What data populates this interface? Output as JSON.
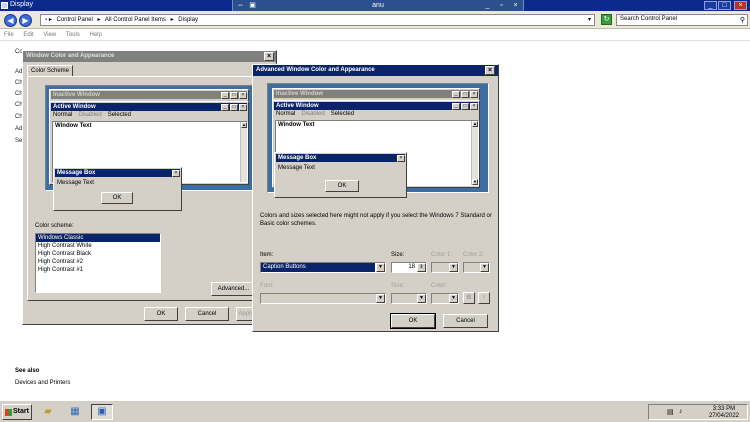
{
  "explorer": {
    "title": "Display",
    "remote_title": "anu",
    "path": [
      "Control Panel",
      "All Control Panel Items",
      "Display"
    ],
    "path_sep": "▸",
    "search_placeholder": "Search Control Panel",
    "menu": [
      "File",
      "Edit",
      "View",
      "Tools",
      "Help"
    ],
    "left_letters": [
      "Co",
      "Ad",
      "Ch",
      "Ch",
      "Ch",
      "Ch",
      "Ad",
      "Se"
    ],
    "see_also_heading": "See also",
    "see_also_link": "Devices and Printers"
  },
  "wca": {
    "title": "Window Color and Appearance",
    "tab": "Color Scheme",
    "preview": {
      "inactive_title": "Inactive Window",
      "active_title": "Active Window",
      "menu_normal": "Normal",
      "menu_disabled": "Disabled",
      "menu_selected": "Selected",
      "window_text": "Window Text",
      "msgbox_title": "Message Box",
      "msgbox_text": "Message Text",
      "ok": "OK"
    },
    "scheme_label": "Color scheme:",
    "schemes": [
      "Windows Classic",
      "High Contrast White",
      "High Contrast Black",
      "High Contrast #2",
      "High Contrast #1"
    ],
    "advanced": "Advanced...",
    "ok": "OK",
    "cancel": "Cancel",
    "apply": "Apply"
  },
  "awca": {
    "title": "Advanced Window Color and Appearance",
    "preview": {
      "inactive_title": "Inactive Window",
      "active_title": "Active Window",
      "menu_normal": "Normal",
      "menu_disabled": "Disabled",
      "menu_selected": "Selected",
      "window_text": "Window Text",
      "msgbox_title": "Message Box",
      "msgbox_text": "Message Text",
      "ok": "OK"
    },
    "note": "Colors and sizes selected here might not apply if you select the Windows 7 Standard or Basic color schemes.",
    "item_label": "Item:",
    "item_value": "Caption Buttons",
    "size_label": "Size:",
    "size_value": "18",
    "color1_label": "Color 1:",
    "color2_label": "Color 2:",
    "font_label": "Font:",
    "size2_label": "Size:",
    "color_label": "Color:",
    "bold": "B",
    "italic": "I",
    "ok": "OK",
    "cancel": "Cancel"
  },
  "taskbar": {
    "start": "Start",
    "time": "3:33 PM",
    "date": "27/04/2022"
  }
}
